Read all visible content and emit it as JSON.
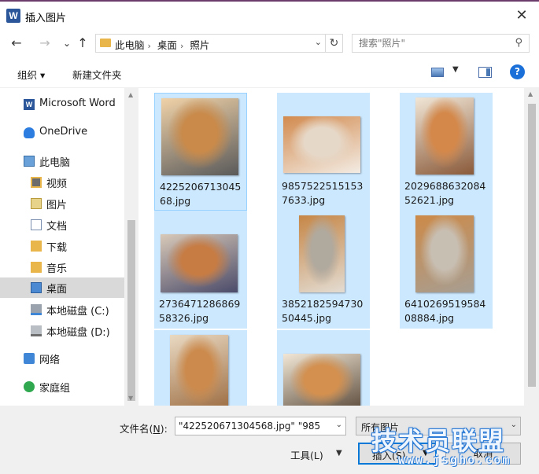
{
  "window": {
    "title": "插入图片",
    "app_icon": "word-icon",
    "close_label": "✕"
  },
  "nav": {
    "back": "←",
    "forward": "→",
    "recent": "⌄",
    "up": "↑",
    "breadcrumbs": [
      "此电脑",
      "桌面",
      "照片"
    ],
    "refresh": "↻",
    "search_placeholder": "搜索\"照片\""
  },
  "toolbar": {
    "organize": "组织 ▾",
    "new_folder": "新建文件夹",
    "view_dropdown": "▼",
    "help": "?"
  },
  "sidebar": {
    "items": [
      {
        "label": "Microsoft Word",
        "icon": "word-icon"
      },
      {
        "label": "OneDrive",
        "icon": "onedrive-icon"
      },
      {
        "label": "此电脑",
        "icon": "computer-icon"
      },
      {
        "label": "视频",
        "icon": "videos-folder-icon"
      },
      {
        "label": "图片",
        "icon": "pictures-folder-icon"
      },
      {
        "label": "文档",
        "icon": "documents-folder-icon"
      },
      {
        "label": "下载",
        "icon": "downloads-folder-icon"
      },
      {
        "label": "音乐",
        "icon": "music-folder-icon"
      },
      {
        "label": "桌面",
        "icon": "desktop-folder-icon",
        "selected": true
      },
      {
        "label": "本地磁盘 (C:)",
        "icon": "drive-c-icon"
      },
      {
        "label": "本地磁盘 (D:)",
        "icon": "drive-d-icon"
      },
      {
        "label": "网络",
        "icon": "network-icon"
      },
      {
        "label": "家庭组",
        "icon": "homegroup-icon"
      }
    ]
  },
  "files": [
    {
      "name_line1": "4225206713045",
      "name_line2": "68.jpg",
      "palette": [
        "#c98a4a",
        "#f0d2a8",
        "#5a5a5a"
      ]
    },
    {
      "name_line1": "9857522515153",
      "name_line2": "7633.jpg",
      "palette": [
        "#e6d8c8",
        "#d28a4e",
        "#f3ece4"
      ]
    },
    {
      "name_line1": "2029688632084",
      "name_line2": "52621.jpg",
      "palette": [
        "#d4884a",
        "#f1e6d6",
        "#8a5a3a"
      ]
    },
    {
      "name_line1": "2736471286869",
      "name_line2": "58326.jpg",
      "palette": [
        "#c77c44",
        "#d8c9b8",
        "#4b4b6a"
      ]
    },
    {
      "name_line1": "3852182594730",
      "name_line2": "50445.jpg",
      "palette": [
        "#b0a99e",
        "#c68646",
        "#e3dcd2"
      ]
    },
    {
      "name_line1": "6410269519584",
      "name_line2": "08884.jpg",
      "palette": [
        "#c8bfb3",
        "#cd8a48",
        "#a79e92"
      ]
    },
    {
      "name_line1": "",
      "name_line2": "",
      "palette": [
        "#cc8a4c",
        "#e9d9c2",
        "#9b6b40"
      ]
    },
    {
      "name_line1": "",
      "name_line2": "",
      "palette": [
        "#d3904f",
        "#f2e7d6",
        "#5a4a3a"
      ]
    }
  ],
  "bottom": {
    "filename_label_prefix": "文件名(",
    "filename_label_key": "N",
    "filename_label_suffix": "):",
    "filename_value": "\"422520671304568.jpg\" \"985",
    "filter_value": "所有图片",
    "tools_label": "工具(L)",
    "insert_label": "插入(S)",
    "cancel_label": "取消"
  },
  "watermark": {
    "main": "技术员联盟",
    "sub": "www.jsgho.com"
  }
}
